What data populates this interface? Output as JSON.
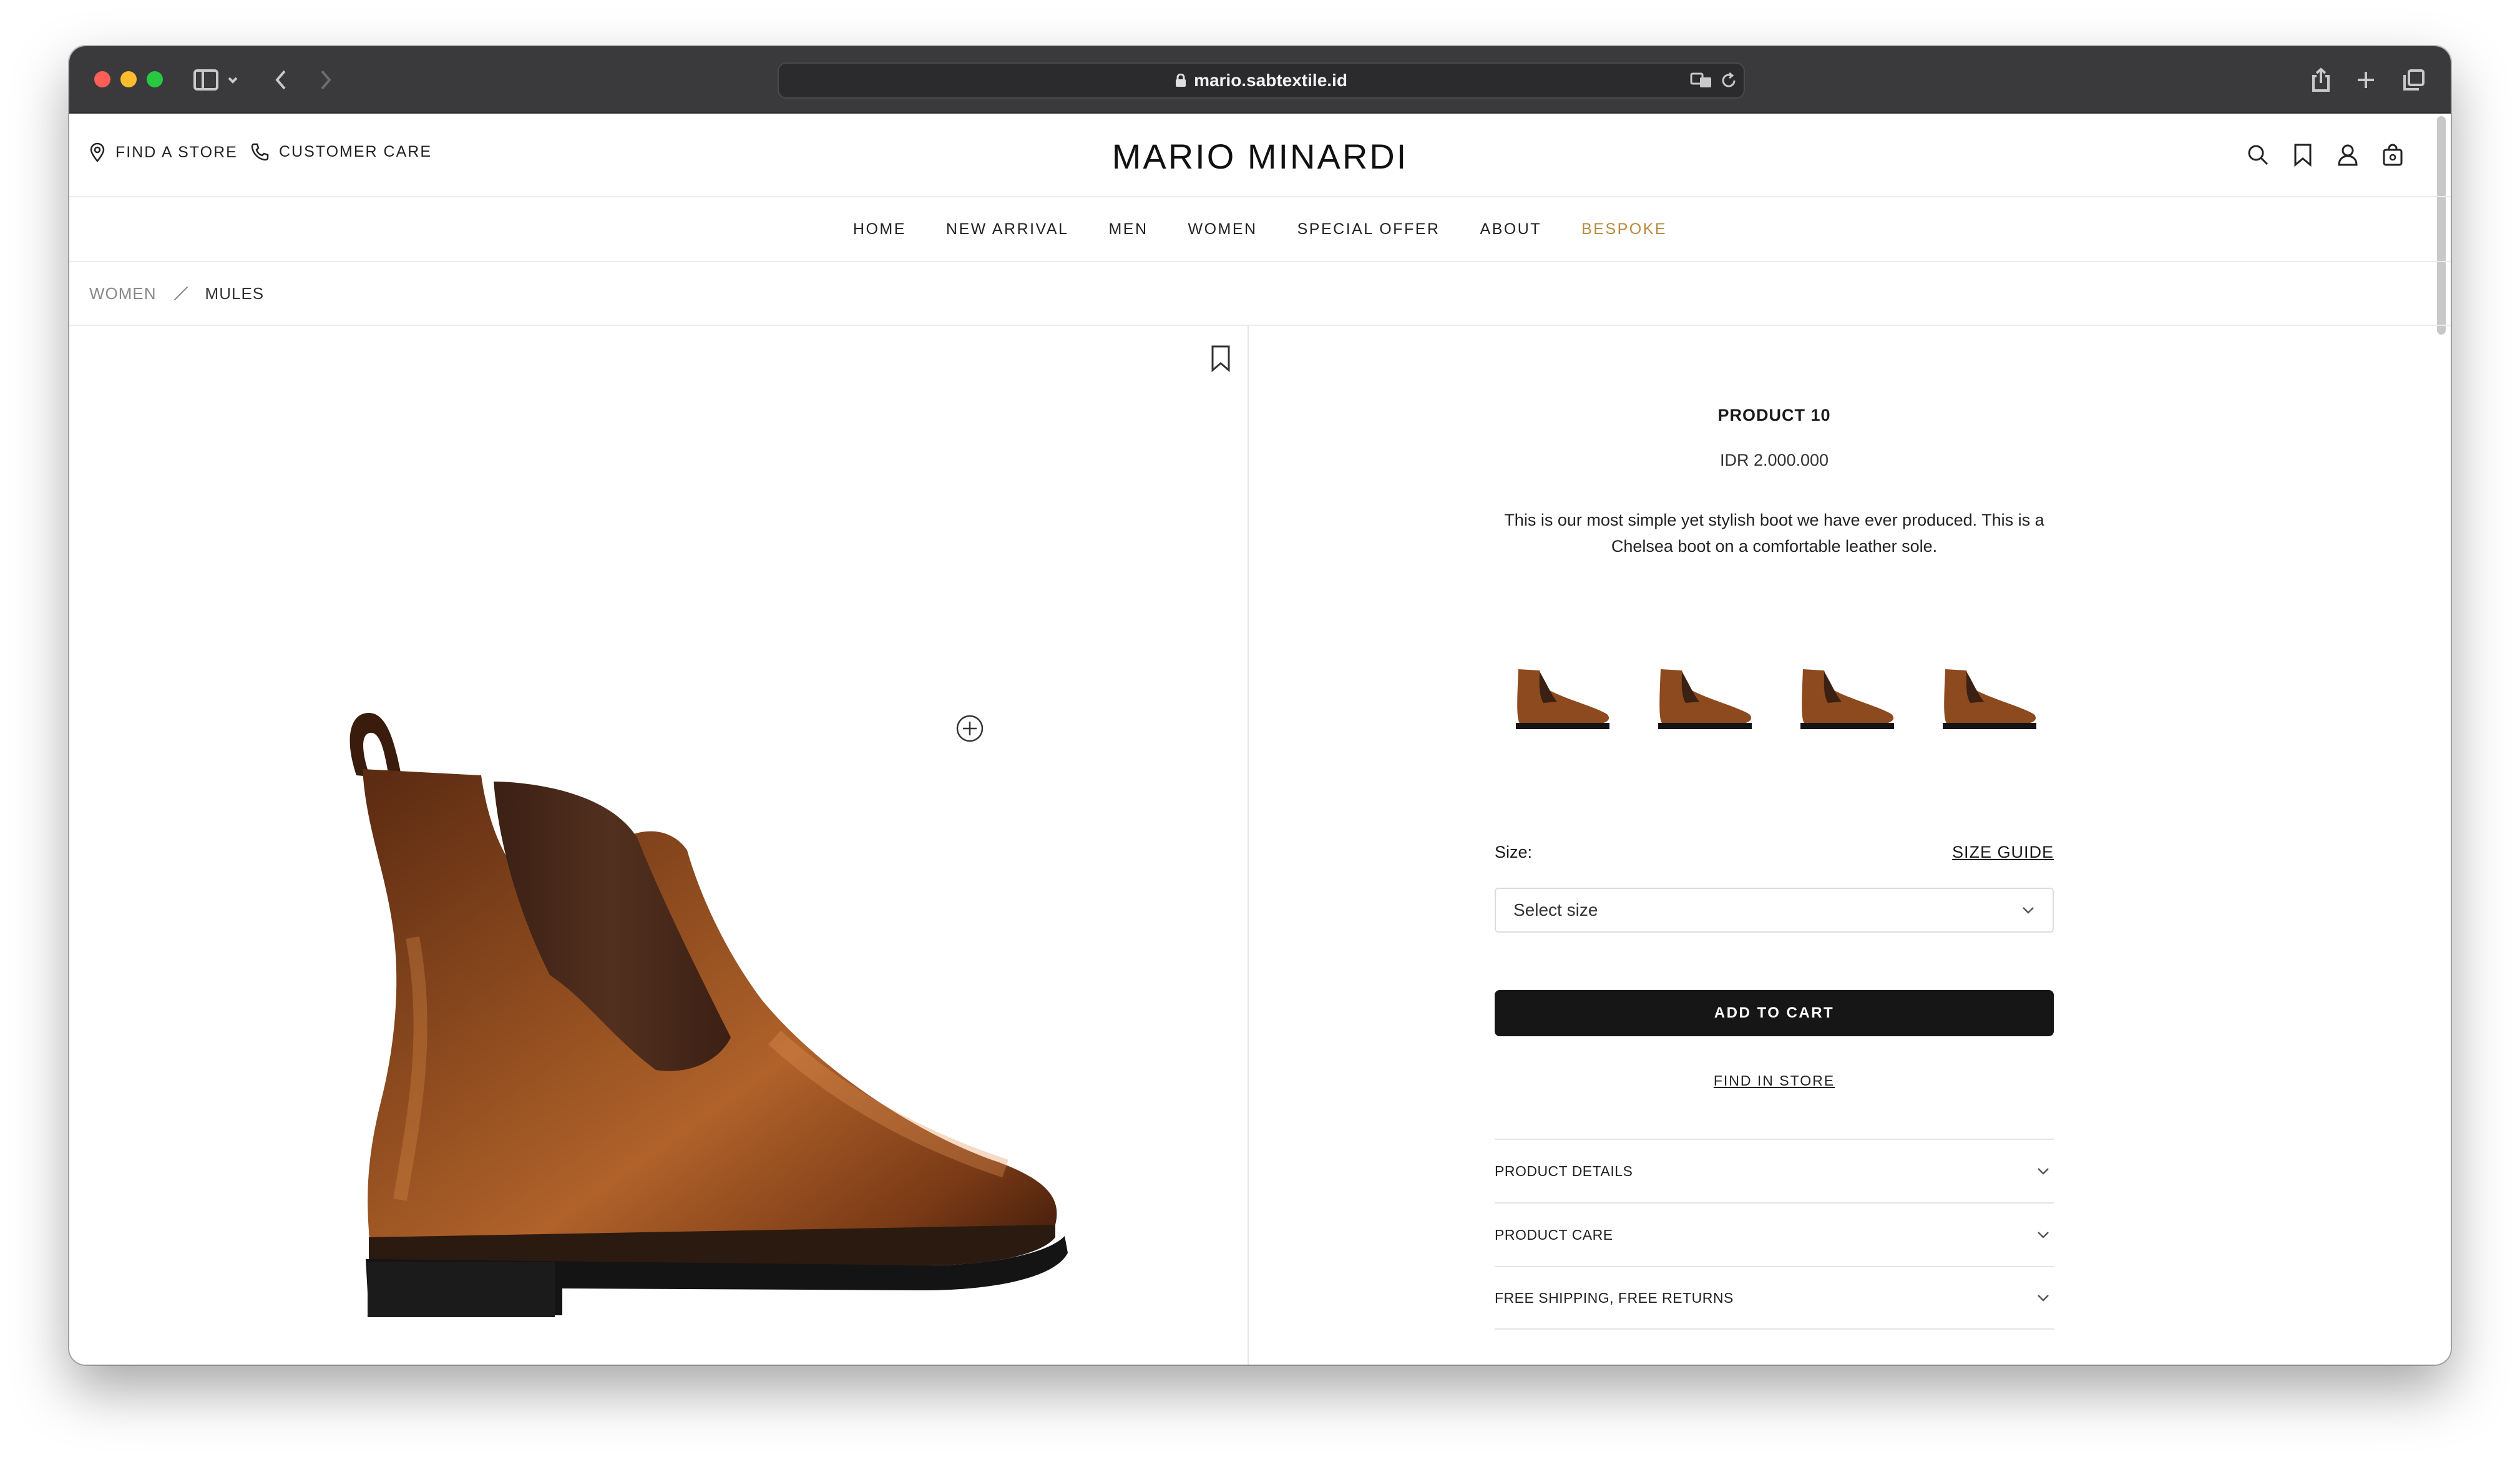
{
  "browser": {
    "url": "mario.sabtextile.id"
  },
  "header": {
    "find_store": "FIND A STORE",
    "customer_care": "CUSTOMER CARE",
    "logo": "MARIO MINARDI"
  },
  "nav": {
    "items": [
      {
        "label": "HOME"
      },
      {
        "label": "NEW ARRIVAL"
      },
      {
        "label": "MEN"
      },
      {
        "label": "WOMEN"
      },
      {
        "label": "SPECIAL OFFER"
      },
      {
        "label": "ABOUT"
      },
      {
        "label": "BESPOKE"
      }
    ],
    "accent_color": "#b78a3f"
  },
  "breadcrumb": {
    "items": [
      "WOMEN",
      "MULES"
    ]
  },
  "product": {
    "title": "PRODUCT 10",
    "price": "IDR 2.000.000",
    "description": "This is our most simple yet stylish boot we have ever produced. This is a Chelsea boot on a comfortable leather sole.",
    "size_label": "Size:",
    "size_guide": "SIZE GUIDE",
    "size_placeholder": "Select size",
    "add_to_cart": "ADD TO CART",
    "find_in_store": "FIND IN STORE",
    "accordions": [
      {
        "label": "PRODUCT DETAILS"
      },
      {
        "label": "PRODUCT CARE"
      },
      {
        "label": "FREE SHIPPING, FREE RETURNS"
      }
    ],
    "thumbnail_count": 4,
    "boot_color": "#7a3e1a"
  }
}
